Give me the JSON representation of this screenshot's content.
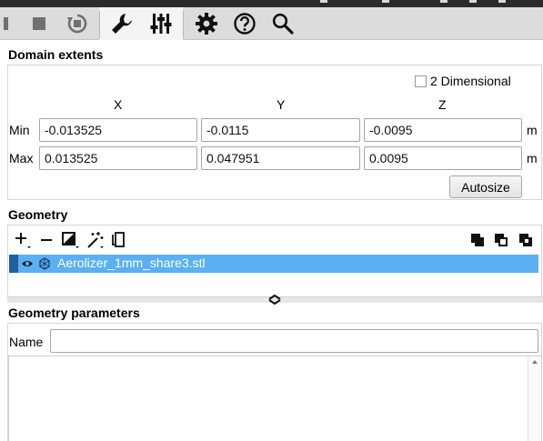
{
  "toolbar": {
    "buttons": [
      "stop-icon",
      "reset-icon",
      "wrench-icon",
      "sliders-icon",
      "gear-icon",
      "help-icon",
      "search-icon"
    ]
  },
  "domain": {
    "title": "Domain extents",
    "two_dimensional_label": "2 Dimensional",
    "two_dimensional_checked": false,
    "axes": {
      "x": "X",
      "y": "Y",
      "z": "Z"
    },
    "min": {
      "label": "Min",
      "x": "-0.013525",
      "y": "-0.0115",
      "z": "-0.0095",
      "unit": "m"
    },
    "max": {
      "label": "Max",
      "x": "0.013525",
      "y": "0.047951",
      "z": "0.0095",
      "unit": "m"
    },
    "autosize_label": "Autosize"
  },
  "geometry": {
    "title": "Geometry",
    "items": [
      {
        "name": "Aerolizer_1mm_share3.stl",
        "visible": true,
        "selected": true
      }
    ]
  },
  "geometry_parameters": {
    "title": "Geometry parameters",
    "name_label": "Name",
    "name_value": ""
  },
  "colors": {
    "selection": "#5ab0f2",
    "toolbar_bg": "#dcdcdc"
  }
}
